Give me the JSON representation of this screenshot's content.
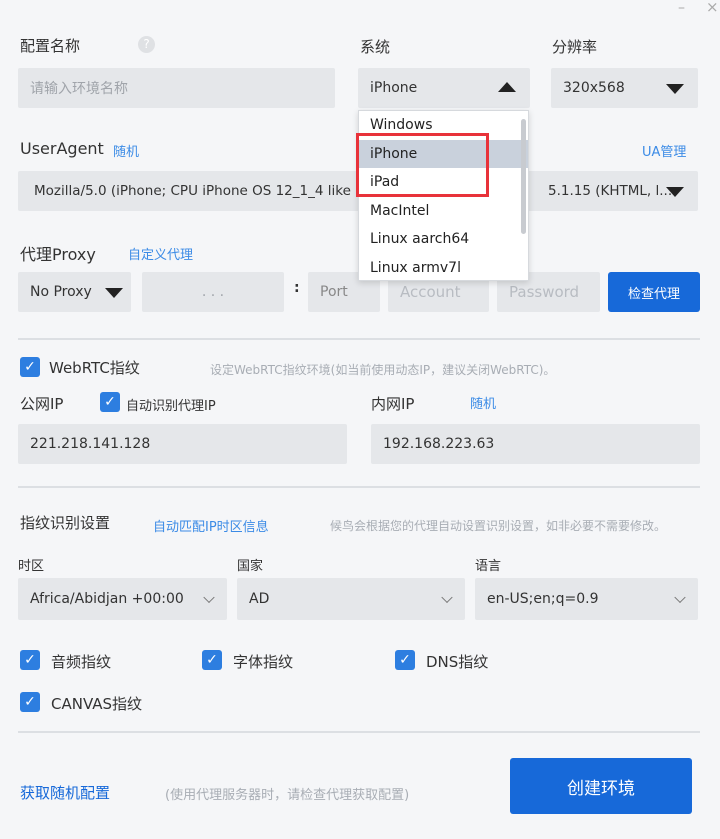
{
  "window": {
    "minimize": "–",
    "close": "×"
  },
  "config_name": {
    "label": "配置名称",
    "help": "?",
    "placeholder": "请输入环境名称"
  },
  "system": {
    "label": "系统",
    "value": "iPhone",
    "options": [
      "Windows",
      "iPhone",
      "iPad",
      "MacIntel",
      "Linux aarch64",
      "Linux armv7l"
    ],
    "highlighted": "iPhone"
  },
  "resolution": {
    "label": "分辨率",
    "value": "320x568"
  },
  "useragent": {
    "label": "UserAgent",
    "random": "随机",
    "manage": "UA管理",
    "value_left": "Mozilla/5.0 (iPhone; CPU iPhone OS 12_1_4 like M",
    "value_right": "5.1.15 (KHTML, l..."
  },
  "proxy": {
    "label": "代理Proxy",
    "custom": "自定义代理",
    "type": "No Proxy",
    "ip_placeholder": ".   .   .",
    "colon": ":",
    "port_placeholder": "Port",
    "account_placeholder": "Account",
    "password_placeholder": "Password",
    "check_button": "检查代理"
  },
  "webrtc": {
    "label": "WebRTC指纹",
    "checked": true,
    "hint": "设定WebRTC指纹环境(如当前使用动态IP，建议关闭WebRTC)。"
  },
  "public_ip": {
    "label": "公网IP",
    "auto_label": "自动识别代理IP",
    "auto_checked": true,
    "value": "221.218.141.128"
  },
  "local_ip": {
    "label": "内网IP",
    "random": "随机",
    "value": "192.168.223.63"
  },
  "fingerprint": {
    "label": "指纹识别设置",
    "auto_match": "自动匹配IP时区信息",
    "hint": "候鸟会根据您的代理自动设置识别设置，如非必要不需要修改。"
  },
  "timezone": {
    "label": "时区",
    "value": "Africa/Abidjan +00:00"
  },
  "country": {
    "label": "国家",
    "value": "AD"
  },
  "language": {
    "label": "语言",
    "value": "en-US;en;q=0.9"
  },
  "checks": [
    {
      "label": "音频指纹",
      "checked": true
    },
    {
      "label": "字体指纹",
      "checked": true
    },
    {
      "label": "DNS指纹",
      "checked": true
    },
    {
      "label": "CANVAS指纹",
      "checked": true
    }
  ],
  "footer": {
    "random_config": "获取随机配置",
    "hint": "(使用代理服务器时，请检查代理获取配置)",
    "create_button": "创建环境"
  },
  "colors": {
    "accent": "#1769d9",
    "link": "#3b8be6",
    "highlight_box": "#e8323a"
  }
}
